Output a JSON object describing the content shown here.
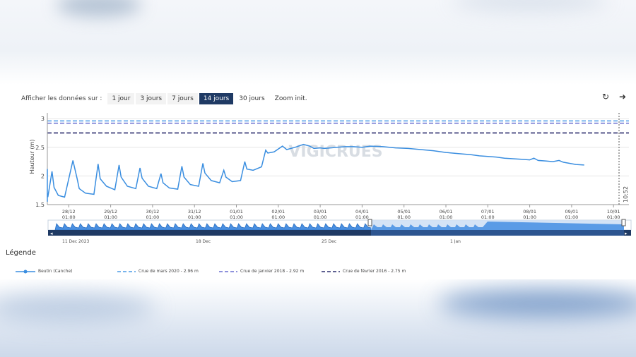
{
  "toolbar": {
    "label": "Afficher les données sur :",
    "buttons": [
      "1 jour",
      "3 jours",
      "7 jours",
      "14 jours",
      "30 jours",
      "Zoom init."
    ],
    "active_index": 3,
    "refresh_icon": "refresh-icon",
    "export_icon": "share-arrow-icon"
  },
  "legend": {
    "title": "Légende",
    "items": [
      {
        "label": "Beutin (Canche)",
        "style": "solid-marker",
        "color": "#3a8ee0"
      },
      {
        "label": "Crue de mars 2020 - 2.96 m",
        "style": "dashed",
        "color": "#4b9be6"
      },
      {
        "label": "Crue de janvier 2018 - 2.92 m",
        "style": "dashed",
        "color": "#6a6fd0"
      },
      {
        "label": "Crue de février 2016 - 2.75 m",
        "style": "dashed",
        "color": "#2c2f6e"
      }
    ]
  },
  "navigator": {
    "labels": [
      "11 Dec 2023",
      "18 Dec",
      "25 Dec",
      "1 Jan"
    ],
    "label_x": [
      25.6,
      26.5,
      27.9,
      28.6
    ]
  },
  "chart_data": {
    "type": "line",
    "title": "",
    "ylabel": "Hauteur (m)",
    "xlabel": "",
    "ylim": [
      1.5,
      3.1
    ],
    "yticks": [
      "1.5",
      "2",
      "2.5",
      "3"
    ],
    "watermark": "VIGICRUES",
    "now_label": "10:52",
    "x_tick_labels": [
      [
        "28/12",
        "01:00"
      ],
      [
        "29/12",
        "01:00"
      ],
      [
        "30/12",
        "01:00"
      ],
      [
        "31/12",
        "01:00"
      ],
      [
        "01/01",
        "01:00"
      ],
      [
        "02/01",
        "01:00"
      ],
      [
        "03/01",
        "01:00"
      ],
      [
        "04/01",
        "01:00"
      ],
      [
        "05/01",
        "01:00"
      ],
      [
        "06/01",
        "01:00"
      ],
      [
        "07/01",
        "01:00"
      ],
      [
        "08/01",
        "01:00"
      ],
      [
        "09/01",
        "01:00"
      ],
      [
        "10/01",
        "01:00"
      ]
    ],
    "thresholds": [
      {
        "name": "Crue de mars 2020 - 2.96 m",
        "value": 2.96,
        "color": "#4b9be6"
      },
      {
        "name": "Crue de janvier 2018 - 2.92 m",
        "value": 2.92,
        "color": "#6a6fd0"
      },
      {
        "name": "Crue de février 2016 - 2.75 m",
        "value": 2.75,
        "color": "#2c2f6e"
      }
    ],
    "series": [
      {
        "name": "Beutin (Canche)",
        "color": "#3a8ee0",
        "x": [
          -0.5,
          -0.45,
          -0.4,
          -0.25,
          -0.1,
          0.05,
          0.1,
          0.15,
          0.3,
          0.5,
          0.6,
          0.65,
          0.75,
          0.9,
          1.1,
          1.2,
          1.25,
          1.4,
          1.6,
          1.7,
          1.75,
          1.9,
          2.1,
          2.2,
          2.25,
          2.4,
          2.6,
          2.7,
          2.75,
          2.9,
          3.1,
          3.2,
          3.25,
          3.4,
          3.6,
          3.7,
          3.75,
          3.9,
          4.1,
          4.2,
          4.25,
          4.4,
          4.6,
          4.7,
          4.75,
          4.9,
          5.1,
          5.2,
          5.25,
          5.4,
          5.6,
          5.7,
          5.75,
          5.9,
          6.1,
          6.2,
          6.4,
          6.6,
          6.75,
          6.85,
          7.0,
          7.1,
          7.25,
          7.4,
          7.6,
          7.8,
          8.0,
          8.2,
          8.5,
          8.8,
          9.1,
          9.4,
          9.7,
          10.0,
          10.3,
          10.6,
          10.8,
          11.0,
          11.2,
          11.4,
          11.6,
          11.8,
          12.0,
          12.1,
          12.2,
          12.4,
          12.55,
          12.7,
          12.8,
          12.95,
          13.1,
          13.3
        ],
        "y": [
          1.55,
          2.05,
          2.12,
          1.72,
          1.64,
          1.62,
          2.01,
          1.78,
          1.66,
          1.63,
          2.08,
          1.8,
          1.66,
          1.63,
          2.27,
          1.95,
          1.78,
          1.7,
          1.68,
          2.21,
          1.95,
          1.82,
          1.76,
          2.19,
          1.98,
          1.82,
          1.78,
          2.14,
          1.96,
          1.82,
          1.78,
          2.04,
          1.88,
          1.79,
          1.77,
          2.17,
          1.98,
          1.85,
          1.82,
          2.22,
          2.05,
          1.92,
          1.88,
          2.1,
          1.98,
          1.9,
          1.92,
          2.25,
          2.12,
          2.1,
          2.16,
          2.45,
          2.4,
          2.42,
          2.52,
          2.46,
          2.5,
          2.55,
          2.52,
          2.48,
          2.49,
          2.48,
          2.49,
          2.5,
          2.51,
          2.51,
          2.5,
          2.52,
          2.51,
          2.49,
          2.48,
          2.46,
          2.44,
          2.41,
          2.39,
          2.37,
          2.35,
          2.34,
          2.33,
          2.31,
          2.3,
          2.29,
          2.28,
          2.31,
          2.27,
          2.26,
          2.25,
          2.27,
          2.24,
          2.22,
          2.2,
          2.19
        ]
      }
    ]
  }
}
